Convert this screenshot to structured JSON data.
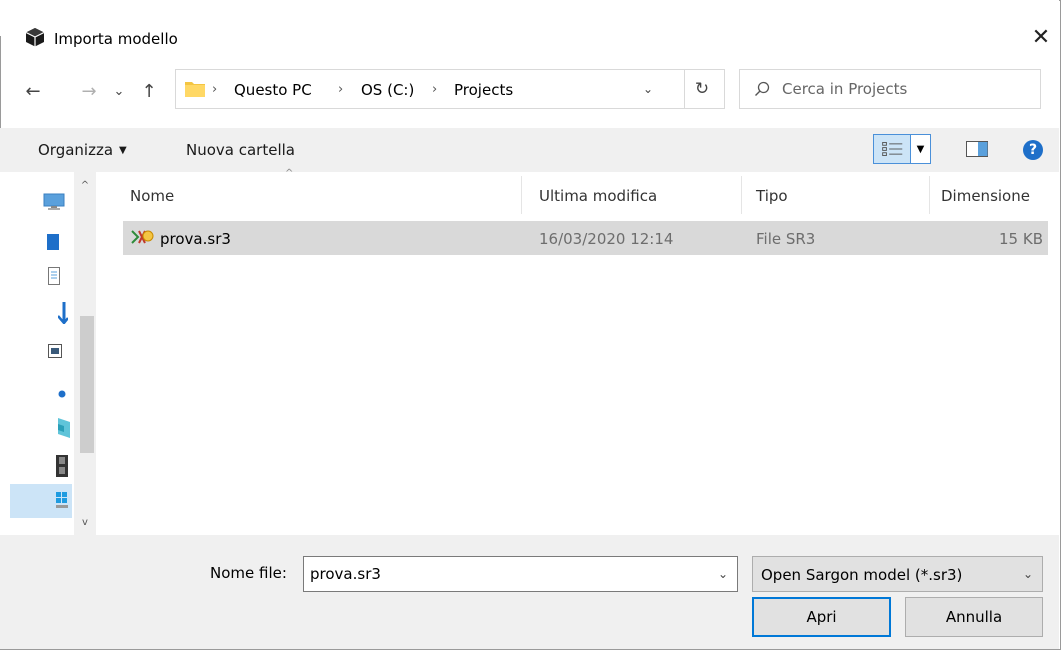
{
  "window": {
    "title": "Importa modello",
    "close_glyph": "✕"
  },
  "nav": {
    "back_glyph": "←",
    "forward_glyph": "→",
    "recent_glyph": "⌄",
    "up_glyph": "↑",
    "breadcrumbs": [
      "Questo PC",
      "OS (C:)",
      "Projects"
    ],
    "separator": "›",
    "dropdown_glyph": "⌄",
    "refresh_glyph": "↻"
  },
  "search": {
    "placeholder": "Cerca in Projects"
  },
  "command_bar": {
    "organize_label": "Organizza",
    "organize_caret": "▼",
    "new_folder_label": "Nuova cartella",
    "view_caret": "▼",
    "help_glyph": "?"
  },
  "file_list": {
    "columns": [
      "Nome",
      "Ultima modifica",
      "Tipo",
      "Dimensione"
    ],
    "sort_caret": "^",
    "rows": [
      {
        "name": "prova.sr3",
        "modified": "16/03/2020 12:14",
        "type": "File SR3",
        "size": "15 KB"
      }
    ]
  },
  "nav_pane": {
    "scroll_up_glyph": "^",
    "scroll_down_glyph": "v",
    "icons": [
      "computer-icon",
      "desktop-icon",
      "documents-icon",
      "downloads-icon",
      "pictures-icon",
      "music-icon",
      "3d-objects-icon",
      "videos-icon",
      "windows-drive-icon"
    ]
  },
  "footer": {
    "filename_label": "Nome file:",
    "filename_value": "prova.sr3",
    "dropdown_glyph": "⌄",
    "filter_value": "Open Sargon model (*.sr3)",
    "open_label": "Apri",
    "cancel_label": "Annulla"
  },
  "colors": {
    "selection": "#cce4f7",
    "row_selected": "#d9d9d9",
    "accent": "#0078d7",
    "folder": "#f4c542"
  }
}
